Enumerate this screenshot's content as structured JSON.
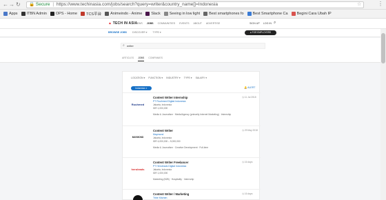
{
  "browser": {
    "secure_label": "Secure",
    "url": "https://www.techinasia.com/jobs/search?query=writer&country_name[]=Indonesia"
  },
  "bookmarks": [
    {
      "label": "Apps",
      "color": "#4a78c8"
    },
    {
      "label": "ITBN Admin",
      "color": "#333333"
    },
    {
      "label": "OPS - Home",
      "color": "#222222"
    },
    {
      "label": "TCS平台",
      "color": "#c0392b"
    },
    {
      "label": "Animeindo - Anime",
      "color": "#555555"
    },
    {
      "label": "Slack",
      "color": "#4a154b"
    },
    {
      "label": "Seeing in low light",
      "color": "#888888"
    },
    {
      "label": "Best smartphones fo",
      "color": "#666666"
    },
    {
      "label": "Best Smartphone Ca",
      "color": "#3a7bd5"
    },
    {
      "label": "Begini Cara Ubah IP",
      "color": "#d9534f"
    }
  ],
  "header": {
    "logo_text": "TECH IN ASIA",
    "nav": [
      "NEWS",
      "JOBS",
      "COMMUNITIES",
      "EVENTS",
      "ABOUT",
      "ADVERTISE"
    ],
    "active_nav": "JOBS",
    "right": [
      "SIGN UP",
      "LOG IN"
    ]
  },
  "subnav": {
    "items": [
      "BROWSE JOBS",
      "DISCOVER ▾",
      "TYPE ▾"
    ],
    "active": "BROWSE JOBS",
    "employers_label": "● FOR EMPLOYERS"
  },
  "search": {
    "value": "writer",
    "tabs": [
      "ARTICLES",
      "JOBS",
      "COMPANIES"
    ],
    "active_tab": "JOBS"
  },
  "filters": {
    "labels": [
      "LOCATION ▾",
      "FUNCTION ▾",
      "INDUSTRY ▾",
      "TYPE ▾",
      "SALARY ▾"
    ],
    "chip": "Indonesia ✕",
    "alert": "ALERT"
  },
  "jobs": [
    {
      "title": "Content Writer Internship",
      "company": "PT Ruuhmed Digital Indonesia",
      "location": "Jakarta, Indonesia",
      "salary": "IDR 1,000,000",
      "tags": "Media & Journalism · Media/Agency (primarily Internet Marketing) · Internship",
      "date": "11 Jul 2018",
      "logo_text": "Ruuhmed",
      "logo_color": "#1e3a8a"
    },
    {
      "title": "Content Writer",
      "company": "Maymond",
      "location": "Jakarta, Indonesia",
      "salary": "IDR 4,000,000 – 5,000,000",
      "tags": "Media & Journalism · Creative Development · Full-time",
      "date": "29 May 2018",
      "logo_text": "MAYMOND",
      "logo_color": "#222222"
    },
    {
      "title": "Content Writer Freelancer",
      "company": "PT Heroleads Digital Indonesia",
      "location": "Jakarta, Indonesia",
      "salary": "IDR 1,000,000",
      "tags": "Marketing (B2B) · Hospitality · Internship",
      "date": "16 days",
      "logo_text": "heroleads",
      "logo_color": "#d62828"
    },
    {
      "title": "Content Writer / Marketing",
      "company": "Tribe Kitchen",
      "location": "",
      "salary": "",
      "tags": "",
      "date": "16 days",
      "logo_text": "",
      "logo_color": "#111111"
    }
  ]
}
